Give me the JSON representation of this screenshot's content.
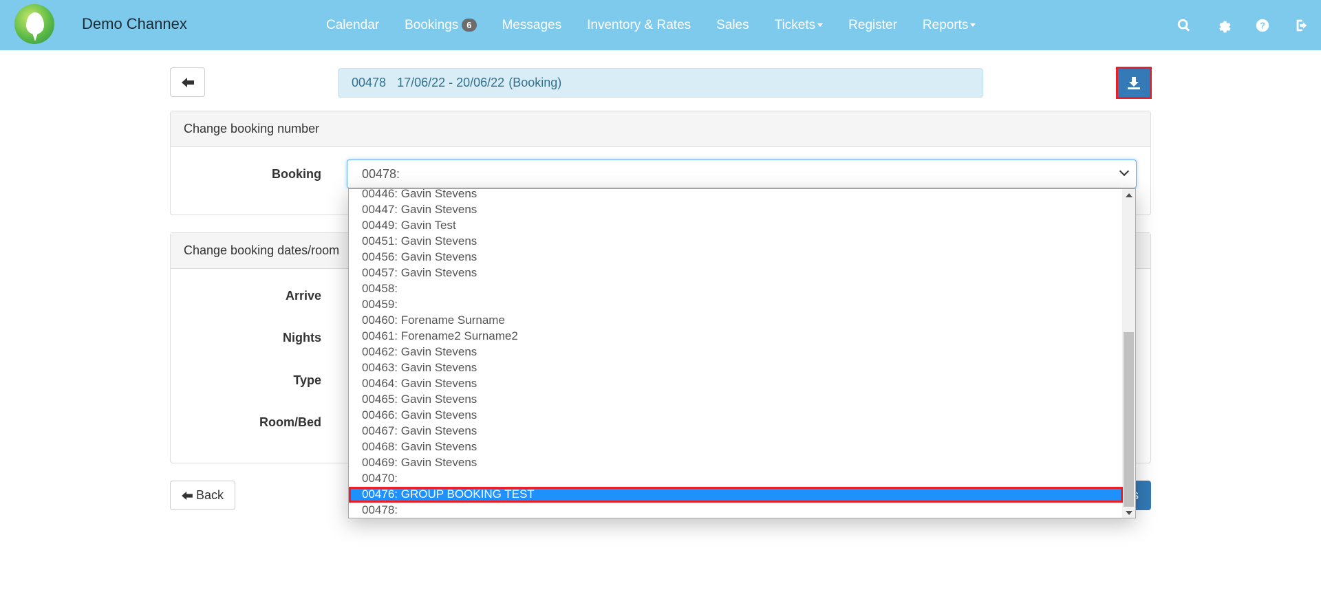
{
  "app": {
    "brand": "Demo Channex"
  },
  "nav": {
    "links": [
      {
        "label": "Calendar"
      },
      {
        "label": "Bookings",
        "badge": "6"
      },
      {
        "label": "Messages"
      },
      {
        "label": "Inventory & Rates"
      },
      {
        "label": "Sales"
      },
      {
        "label": "Tickets",
        "dropdown": true
      },
      {
        "label": "Register"
      },
      {
        "label": "Reports",
        "dropdown": true
      }
    ],
    "icons": [
      "search-icon",
      "gear-icon",
      "help-icon",
      "logout-icon"
    ]
  },
  "header": {
    "booking_no": "00478",
    "dates": "17/06/22 - 20/06/22",
    "type": "(Booking)"
  },
  "panel1": {
    "heading": "Change booking number",
    "booking_label": "Booking",
    "booking_value": "00478:"
  },
  "panel2": {
    "heading": "Change booking dates/room",
    "arrive_label": "Arrive",
    "nights_label": "Nights",
    "type_label": "Type",
    "room_label": "Room/Bed"
  },
  "dropdown": {
    "options": [
      "00446: Gavin Stevens",
      "00447: Gavin Stevens",
      "00449: Gavin Test",
      "00451: Gavin Stevens",
      "00456: Gavin Stevens",
      "00457: Gavin Stevens",
      "00458:",
      "00459:",
      "00460: Forename Surname",
      "00461: Forename2 Surname2",
      "00462: Gavin Stevens",
      "00463: Gavin Stevens",
      "00464: Gavin Stevens",
      "00465: Gavin Stevens",
      "00466: Gavin Stevens",
      "00467: Gavin Stevens",
      "00468: Gavin Stevens",
      "00469: Gavin Stevens",
      "00470:",
      "00476: GROUP BOOKING TEST",
      "00478:"
    ],
    "selected_index": 19
  },
  "buttons": {
    "back_label": "Back",
    "save_partial": "s"
  },
  "colors": {
    "navbar": "#7dcaec",
    "primary": "#337ab7",
    "highlight": "#1e90ff",
    "annotation": "#e8202a",
    "info_bg": "#d9edf7",
    "info_text": "#31708f"
  }
}
